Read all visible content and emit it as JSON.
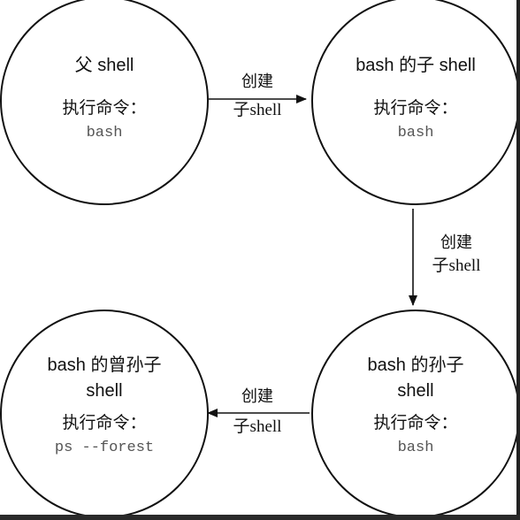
{
  "nodes": {
    "parent": {
      "title": "父 shell",
      "cmd_label": "执行命令：",
      "cmd": "bash"
    },
    "child": {
      "title": "bash 的子 shell",
      "cmd_label": "执行命令：",
      "cmd": "bash"
    },
    "grandchild": {
      "title_line1": "bash 的孙子",
      "title_line2": "shell",
      "cmd_label": "执行命令：",
      "cmd": "bash"
    },
    "great_grandchild": {
      "title_line1": "bash 的曾孙子",
      "title_line2": "shell",
      "cmd_label": "执行命令：",
      "cmd": "ps --forest"
    }
  },
  "edges": [
    {
      "line1": "创建",
      "line2": "子shell"
    },
    {
      "line1": "创建",
      "line2": "子shell"
    },
    {
      "line1": "创建",
      "line2": "子shell"
    }
  ]
}
